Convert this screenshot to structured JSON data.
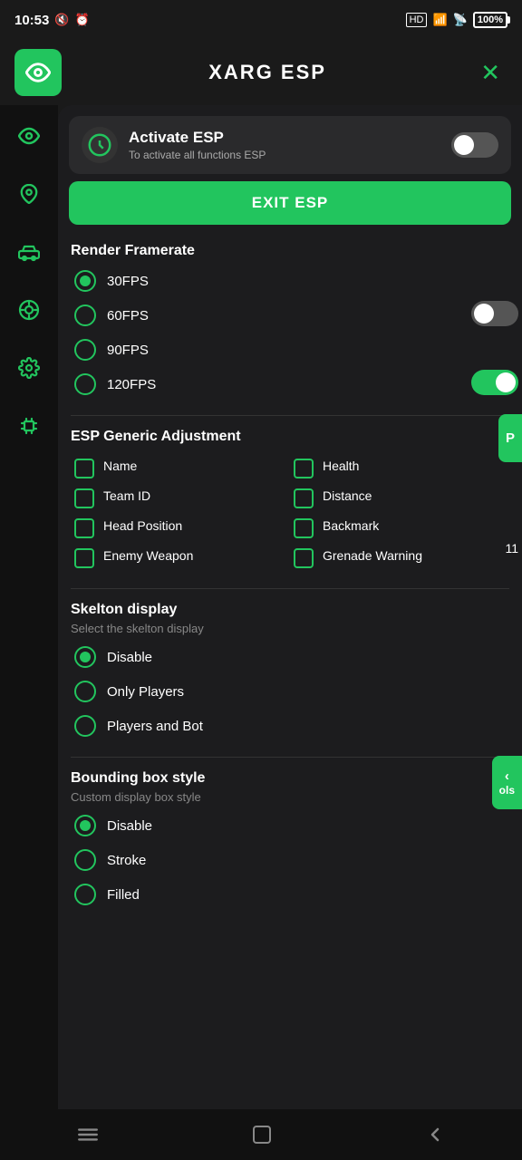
{
  "statusBar": {
    "time": "10:53",
    "battery": "100"
  },
  "header": {
    "title": "XARG ESP",
    "closeLabel": "✕"
  },
  "sidebar": {
    "items": [
      {
        "icon": "👁",
        "name": "eye",
        "label": "Eye"
      },
      {
        "icon": "📍",
        "name": "location",
        "label": "Location"
      },
      {
        "icon": "🚗",
        "name": "vehicle",
        "label": "Vehicle"
      },
      {
        "icon": "🎯",
        "name": "target",
        "label": "Target"
      },
      {
        "icon": "⚙",
        "name": "settings",
        "label": "Settings"
      },
      {
        "icon": "🔲",
        "name": "chip",
        "label": "Chip"
      }
    ]
  },
  "activateESP": {
    "title": "Activate ESP",
    "subtitle": "To activate all functions ESP",
    "toggleState": "off"
  },
  "exitButton": {
    "label": "EXIT ESP"
  },
  "renderFramerate": {
    "sectionTitle": "Render Framerate",
    "options": [
      {
        "label": "30FPS",
        "checked": true
      },
      {
        "label": "60FPS",
        "checked": false
      },
      {
        "label": "90FPS",
        "checked": false
      },
      {
        "label": "120FPS",
        "checked": false
      }
    ]
  },
  "espGenericAdjustment": {
    "sectionTitle": "ESP Generic Adjustment",
    "checkboxes": [
      {
        "label": "Name",
        "checked": false
      },
      {
        "label": "Health",
        "checked": false
      },
      {
        "label": "Team ID",
        "checked": false
      },
      {
        "label": "Distance",
        "checked": false
      },
      {
        "label": "Head Position",
        "checked": false
      },
      {
        "label": "Backmark",
        "checked": false
      },
      {
        "label": "Enemy Weapon",
        "checked": false
      },
      {
        "label": "Grenade Warning",
        "checked": false
      }
    ]
  },
  "skeltonDisplay": {
    "sectionTitle": "Skelton display",
    "subtitle": "Select the skelton display",
    "options": [
      {
        "label": "Disable",
        "checked": true
      },
      {
        "label": "Only Players",
        "checked": false
      },
      {
        "label": "Players and Bot",
        "checked": false
      }
    ]
  },
  "boundingBoxStyle": {
    "sectionTitle": "Bounding box style",
    "subtitle": "Custom display box style",
    "options": [
      {
        "label": "Disable",
        "checked": true
      },
      {
        "label": "Stroke",
        "checked": false
      },
      {
        "label": "Filled",
        "checked": false
      }
    ]
  },
  "floatingTabs": {
    "topTab": "P",
    "bottomTab": "ols",
    "bottomLabel": "< ols"
  },
  "partialText": {
    "right1": "11"
  },
  "bottomNav": {
    "items": [
      {
        "icon": "☰",
        "name": "menu"
      },
      {
        "icon": "⬜",
        "name": "home"
      },
      {
        "icon": "‹",
        "name": "back"
      }
    ]
  }
}
